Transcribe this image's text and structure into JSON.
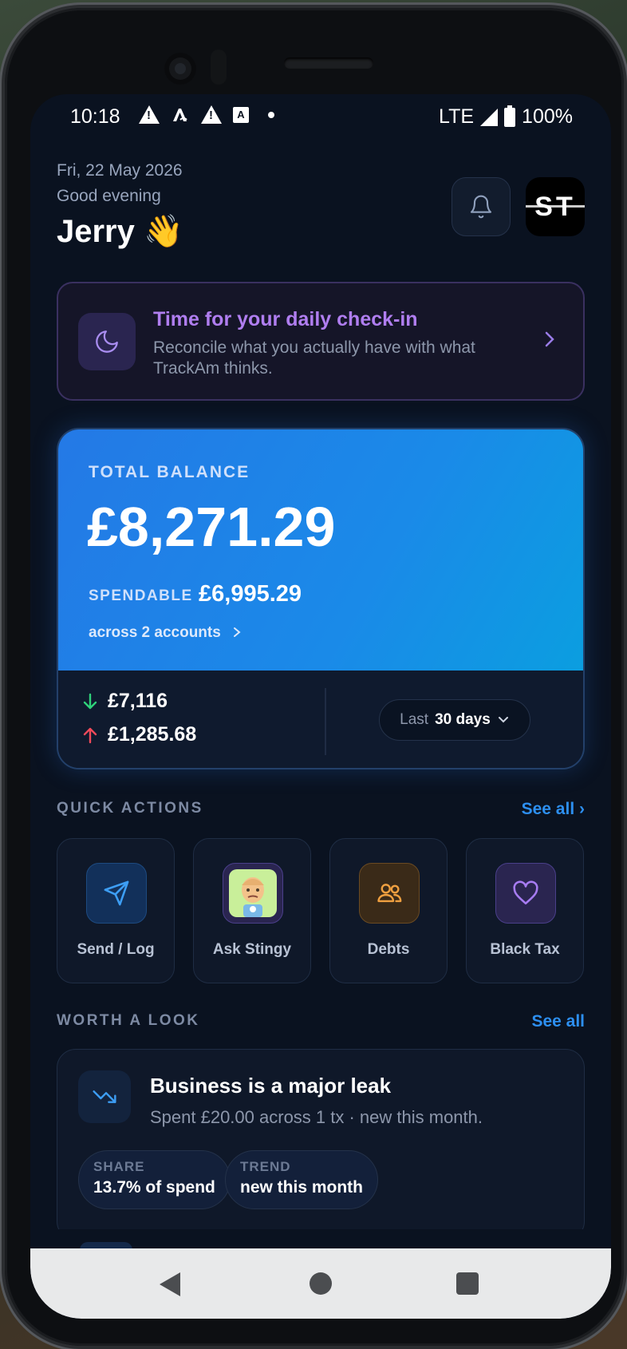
{
  "status_bar": {
    "time": "10:18",
    "network": "LTE",
    "battery": "100%"
  },
  "header": {
    "date": "Fri, 22 May 2026",
    "greeting": "Good evening",
    "name": "Jerry 👋",
    "avatar_initials": "ST"
  },
  "checkin": {
    "title": "Time for your daily check-in",
    "description": "Reconcile what you actually have with what TrackAm thinks."
  },
  "balance": {
    "label": "TOTAL BALANCE",
    "amount": "£8,271.29",
    "spendable_label": "SPENDABLE",
    "spendable_amount": "£6,995.29",
    "accounts_text": "across 2 accounts",
    "money_in": "£7,116",
    "money_out": "£1,285.68",
    "period_label": "Last",
    "period_value": "30 days"
  },
  "quick_actions": {
    "title": "QUICK ACTIONS",
    "see_all": "See all ›",
    "items": [
      {
        "label": "Send / Log",
        "icon": "send-icon",
        "color": "#3d9ef5"
      },
      {
        "label": "Ask Stingy",
        "icon": "stingy-avatar-icon",
        "color": "#9b7cf0"
      },
      {
        "label": "Debts",
        "icon": "people-icon",
        "color": "#f0a040"
      },
      {
        "label": "Black Tax",
        "icon": "heart-icon",
        "color": "#a77cf2"
      }
    ]
  },
  "worth_a_look": {
    "title": "WORTH A LOOK",
    "see_all": "See all",
    "card": {
      "title": "Business is a major leak",
      "description": "Spent £20.00 across 1 tx · new this month.",
      "pills": [
        {
          "label": "SHARE",
          "value": "13.7% of spend"
        },
        {
          "label": "TREND",
          "value": "new this month"
        }
      ]
    }
  },
  "colors": {
    "accent": "#2d8ff0",
    "purple": "#b07ef0",
    "income": "#2fd27a",
    "expense": "#f04a5a",
    "background": "#0a1220"
  }
}
